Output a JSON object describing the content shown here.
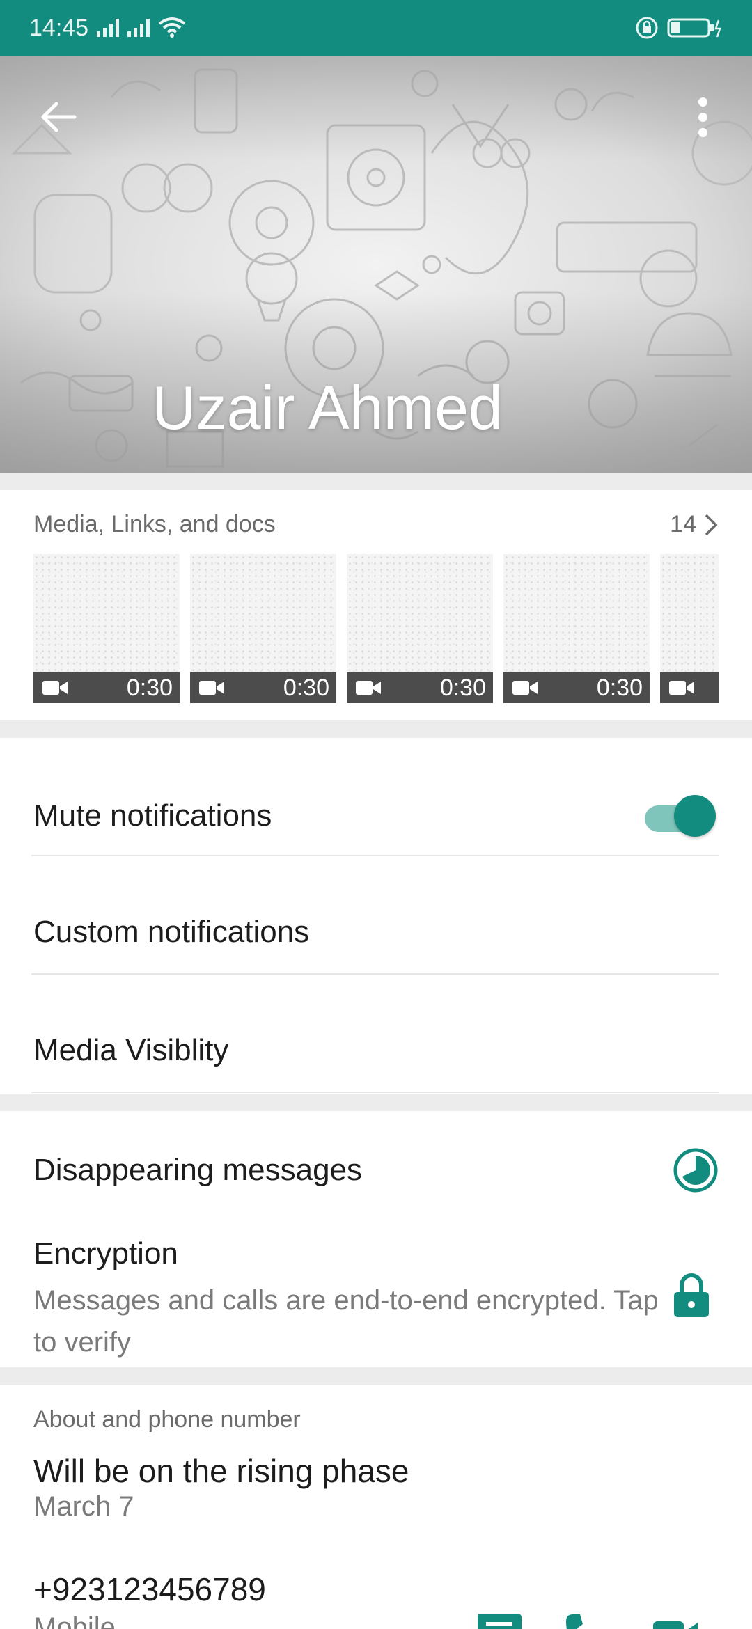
{
  "status_bar": {
    "time": "14:45"
  },
  "header": {
    "contact_name": "Uzair Ahmed"
  },
  "media": {
    "title": "Media, Links, and docs",
    "count": "14",
    "items": [
      {
        "duration": "0:30"
      },
      {
        "duration": "0:30"
      },
      {
        "duration": "0:30"
      },
      {
        "duration": "0:30"
      },
      {
        "duration": ""
      }
    ]
  },
  "settings": {
    "mute_label": "Mute notifications",
    "mute_on": true,
    "custom_label": "Custom notifications",
    "visibility_label": "Media Visiblity"
  },
  "security": {
    "disappearing_label": "Disappearing messages",
    "encryption_title": "Encryption",
    "encryption_desc": "Messages and calls are end-to-end encrypted. Tap to verify"
  },
  "about": {
    "section_label": "About and phone number",
    "status_text": "Will be on the rising phase",
    "status_date": "March 7",
    "phone": "+923123456789",
    "phone_type": "Mobile"
  },
  "colors": {
    "accent": "#128c7e",
    "toggle_track": "#7fc5bb",
    "secondary_text": "#7a7a7a"
  }
}
